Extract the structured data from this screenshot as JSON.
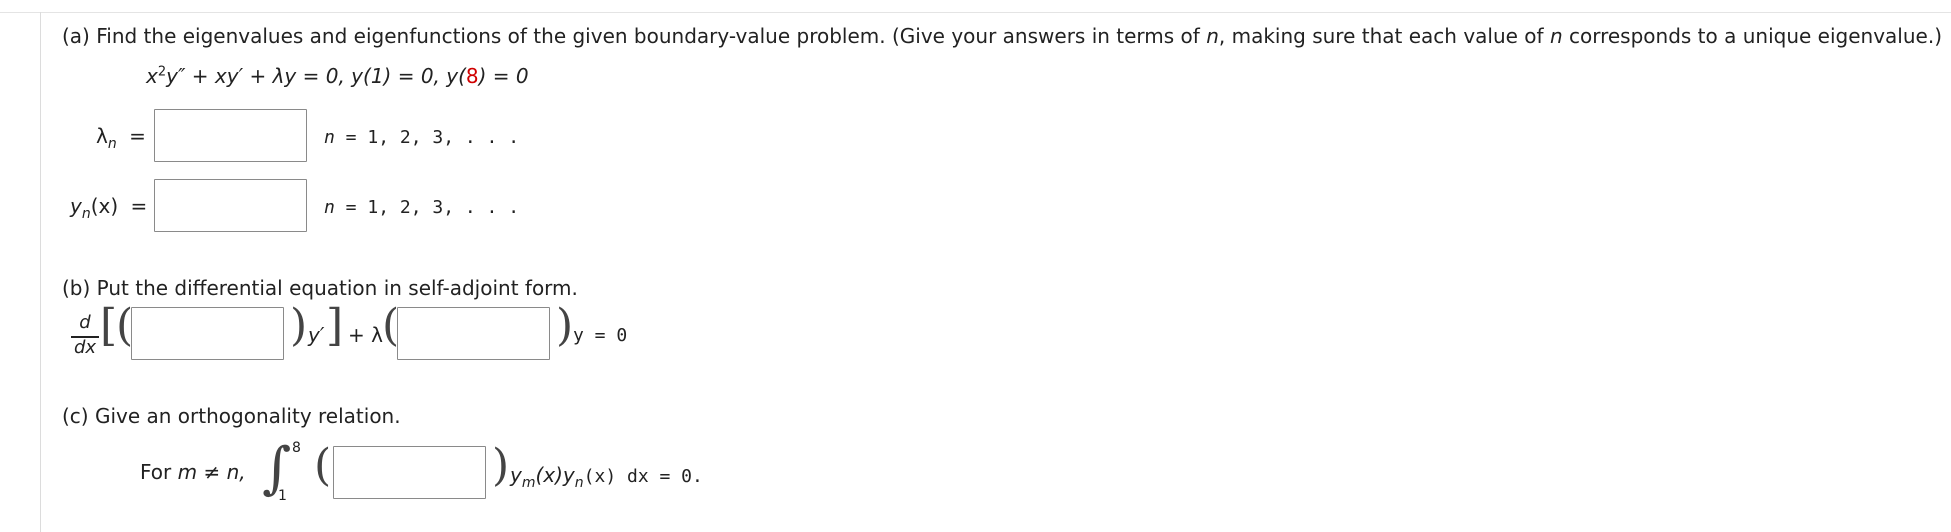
{
  "part_a": {
    "prompt_before": "(a) Find the eigenvalues and eigenfunctions of the given boundary-value problem. (Give your answers in terms of ",
    "prompt_n1": "n",
    "prompt_middle": ", making sure that each value of ",
    "prompt_n2": "n",
    "prompt_after": " corresponds to a unique eigenvalue.)",
    "equation": {
      "x": "x",
      "exp": "2",
      "part1": "y″ + xy′ + λy = 0,  y(1) = 0,  y(",
      "red_value": "8",
      "part2": ") = 0"
    },
    "lambda_label": "λ",
    "lambda_sub": "n",
    "eq_sign": "=",
    "y_label": "y",
    "y_sub": "n",
    "y_arg": "(x)",
    "n_var": "n",
    "n_range": " = 1, 2, 3, . . ."
  },
  "part_b": {
    "prompt": "(b) Put the differential equation in self-adjoint form.",
    "d": "d",
    "dx": "dx",
    "bracket_open": "[",
    "paren_open": "(",
    "paren_close": ")",
    "yprime": "y′",
    "bracket_close": "]",
    "plus_lambda": "+ λ",
    "y_eq_zero": "y = 0"
  },
  "part_c": {
    "prompt": "(c) Give an orthogonality relation.",
    "for_text": "For  ",
    "m_ne_n": "m ≠ n,",
    "integral_sign": "∫",
    "upper_limit": "8",
    "lower_limit": "1",
    "paren_open": "(",
    "paren_close": ")",
    "tail": "y",
    "tail_sub_m": "m",
    "tail_mid": "(x)y",
    "tail_sub_n": "n",
    "tail_end": "(x) dx = 0."
  }
}
